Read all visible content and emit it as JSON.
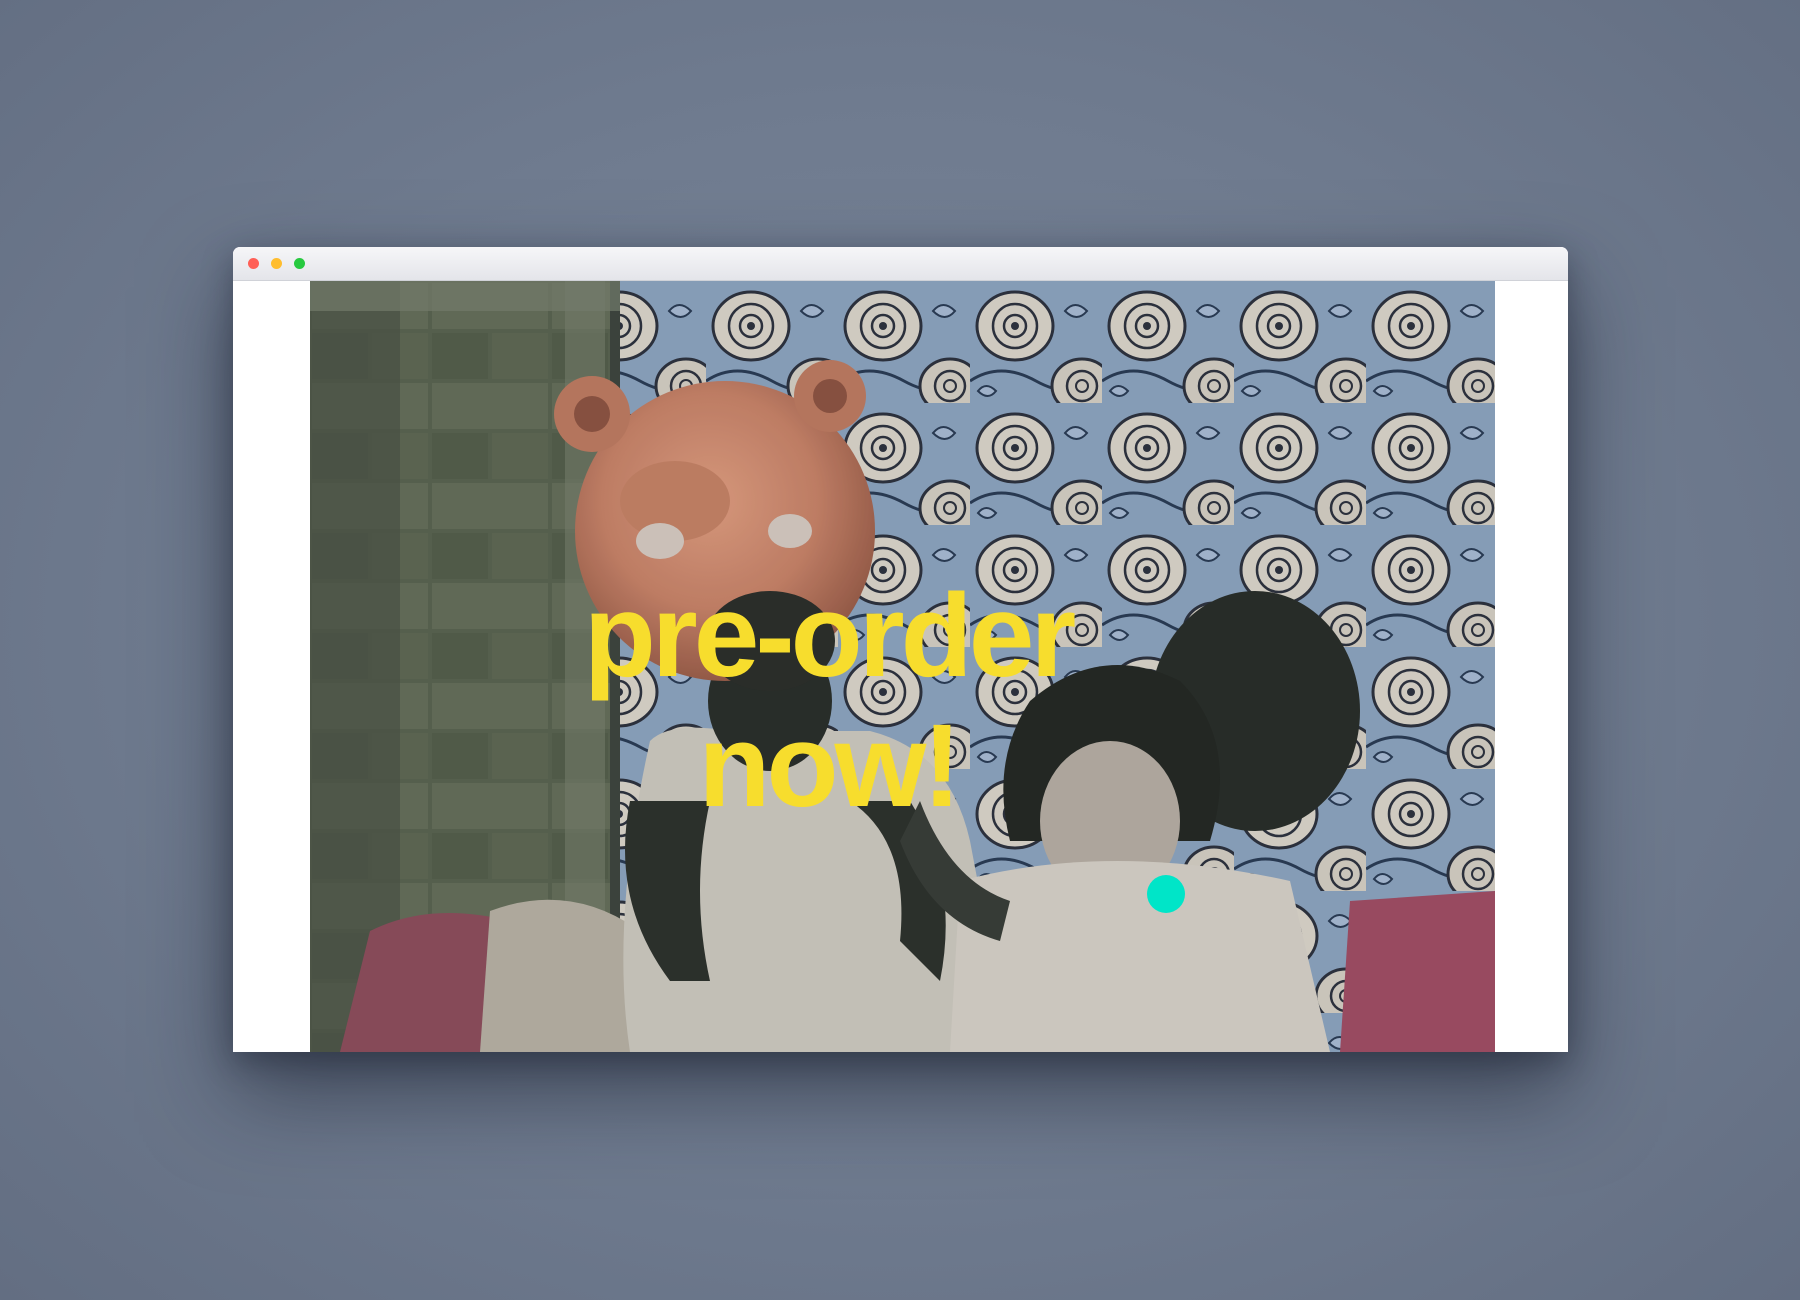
{
  "window": {
    "traffic_lights": [
      {
        "name": "close",
        "color": "#ff5f56"
      },
      {
        "name": "minimize",
        "color": "#ffbd2e"
      },
      {
        "name": "zoom",
        "color": "#27c93f"
      }
    ]
  },
  "hero": {
    "headline_line1": "pre-order",
    "headline_line2": "now!",
    "headline_color": "#f7dd2d",
    "accent_dot_color": "#00e5c8"
  }
}
